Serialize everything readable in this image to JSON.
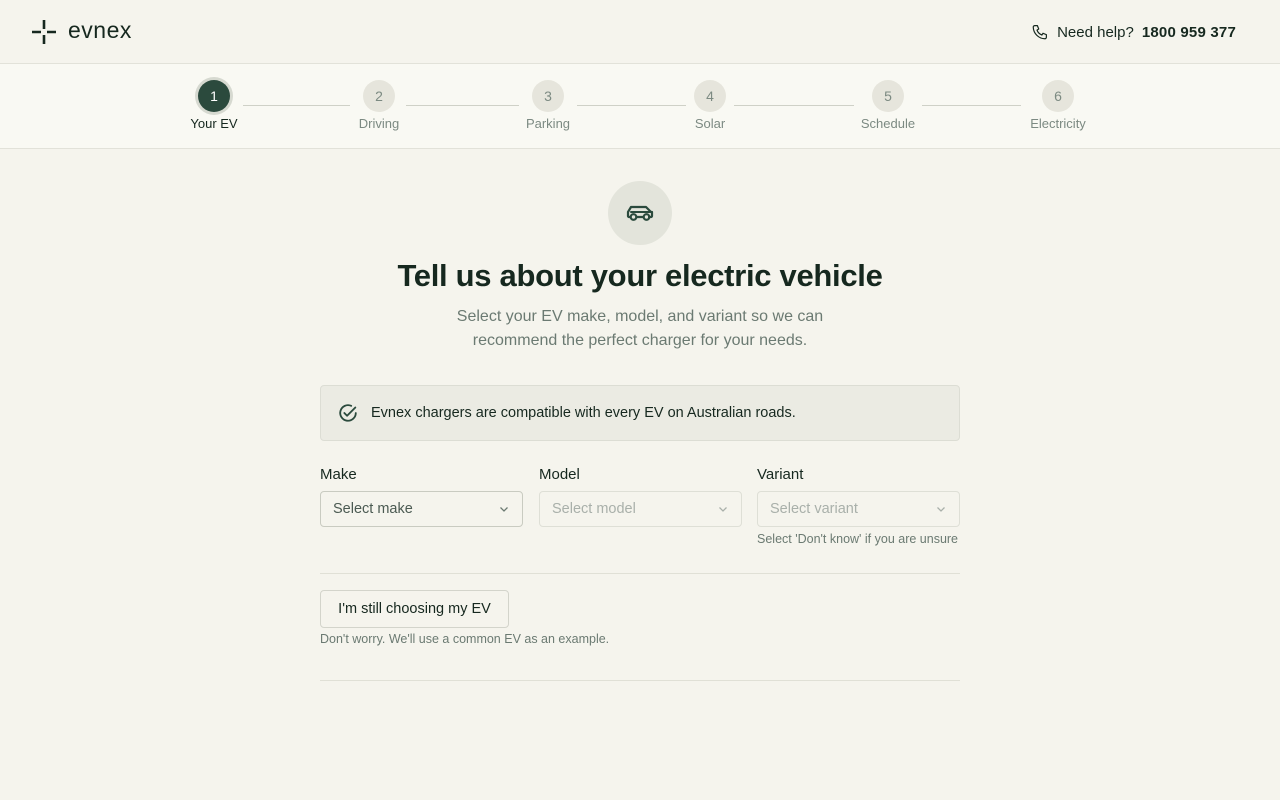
{
  "header": {
    "brand": "evnex",
    "help_label": "Need help?",
    "help_number": "1800 959 377"
  },
  "stepper": {
    "steps": [
      {
        "number": "1",
        "label": "Your EV",
        "state": "active"
      },
      {
        "number": "2",
        "label": "Driving",
        "state": "upcoming"
      },
      {
        "number": "3",
        "label": "Parking",
        "state": "upcoming"
      },
      {
        "number": "4",
        "label": "Solar",
        "state": "upcoming"
      },
      {
        "number": "5",
        "label": "Schedule",
        "state": "upcoming"
      },
      {
        "number": "6",
        "label": "Electricity",
        "state": "upcoming"
      }
    ]
  },
  "main": {
    "icon": "car-icon",
    "title": "Tell us about your electric vehicle",
    "subtitle": "Select your EV make, model, and variant so we can recommend the perfect charger for your needs.",
    "notice": {
      "icon": "check-circle-icon",
      "text": "Evnex chargers are compatible with every EV on Australian roads."
    },
    "fields": {
      "make": {
        "label": "Make",
        "placeholder": "Select make",
        "enabled": true
      },
      "model": {
        "label": "Model",
        "placeholder": "Select model",
        "enabled": false
      },
      "variant": {
        "label": "Variant",
        "placeholder": "Select variant",
        "enabled": false,
        "hint": "Select 'Don't know' if you are unsure"
      }
    },
    "still_choosing": {
      "button_label": "I'm still choosing my EV",
      "note": "Don't worry. We'll use a common EV as an example."
    }
  },
  "colors": {
    "accent": "#2b4a3d",
    "background": "#f5f4ed",
    "text": "#16281f",
    "muted": "#6b7a72"
  }
}
